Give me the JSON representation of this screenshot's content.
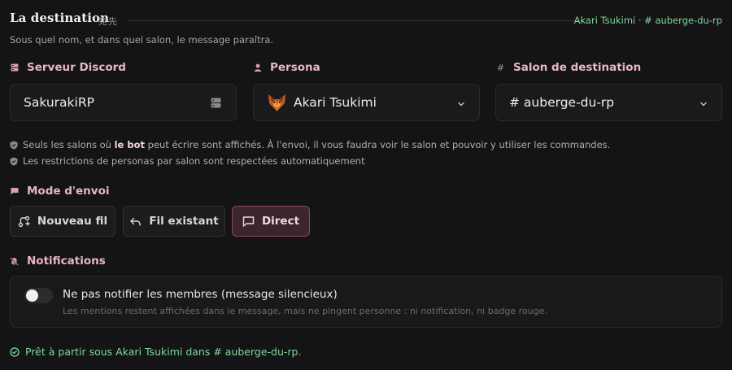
{
  "header": {
    "title": "La destination",
    "title_jp": "宛先",
    "breadcrumb": "Akari Tsukimi · # auberge-du-rp",
    "subtitle": "Sous quel nom, et dans quel salon, le message paraîtra."
  },
  "fields": {
    "server": {
      "label": "Serveur Discord",
      "icon": "server-icon",
      "value": "SakurakiRP"
    },
    "persona": {
      "label": "Persona",
      "icon": "user-icon",
      "value": "Akari Tsukimi",
      "avatar": "fox-avatar-icon"
    },
    "channel": {
      "label": "Salon de destination",
      "icon_text": "#",
      "value": "# auberge-du-rp"
    }
  },
  "notes": {
    "line1_pre": "Seuls les salons où ",
    "line1_bold": "le bot",
    "line1_post": " peut écrire sont affichés. À l'envoi, il vous faudra voir le salon et pouvoir y utiliser les commandes.",
    "line2": "Les restrictions de personas par salon sont respectées automatiquement"
  },
  "mode": {
    "label": "Mode d'envoi",
    "options": [
      {
        "label": "Nouveau fil",
        "icon": "thread-new-icon",
        "active": false
      },
      {
        "label": "Fil existant",
        "icon": "reply-arrow-icon",
        "active": false
      },
      {
        "label": "Direct",
        "icon": "message-square-icon",
        "active": true
      }
    ]
  },
  "notifications": {
    "label": "Notifications",
    "toggle_title": "Ne pas notifier les membres (message silencieux)",
    "toggle_desc": "Les mentions restent affichées dans le message, mais ne pingent personne : ni notification, ni badge rouge.",
    "toggle_on": false
  },
  "status": {
    "text": "Prêt à partir sous Akari Tsukimi dans # auberge-du-rp."
  },
  "colors": {
    "accent": "#e7b6c4",
    "success": "#7fd99a",
    "active_bg": "#3c252e",
    "active_border": "#8a4c62"
  }
}
